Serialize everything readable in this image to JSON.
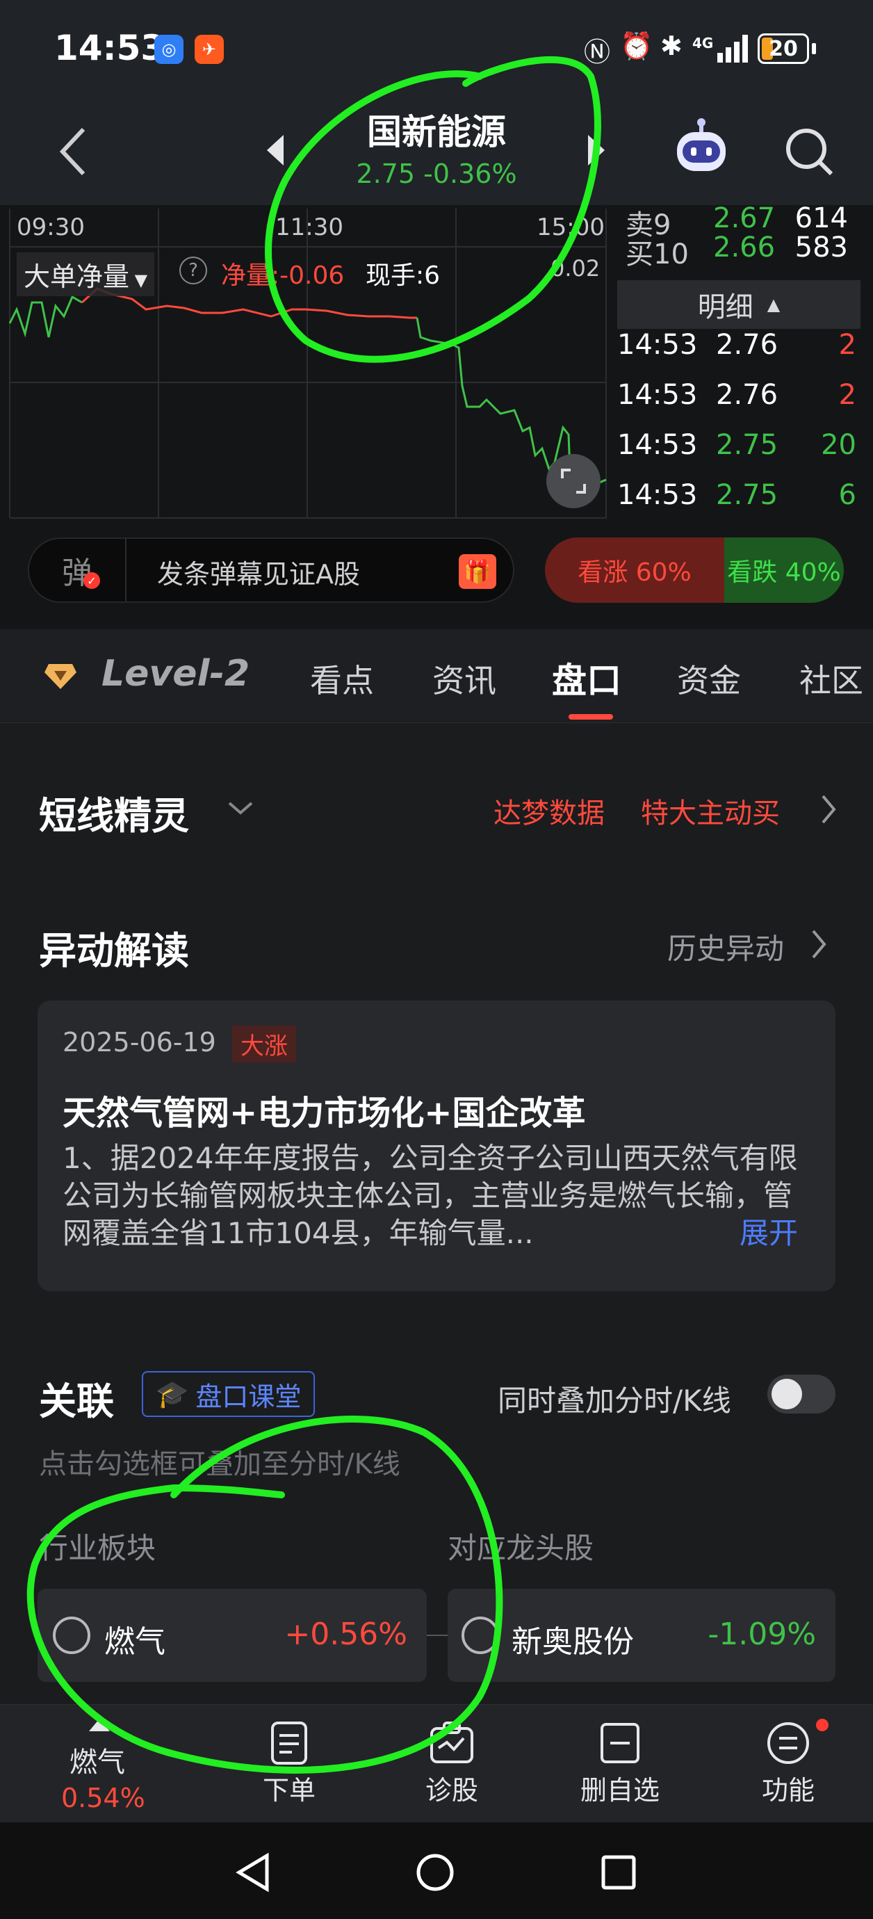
{
  "status": {
    "time": "14:53",
    "battery": "20",
    "network": "4G"
  },
  "header": {
    "title": "国新能源",
    "price": "2.75",
    "change": "-0.36%"
  },
  "chart": {
    "times": [
      "09:30",
      "11:30",
      "15:00"
    ],
    "indicator_label": "大单净量",
    "net_label": "净量:-0.06",
    "hand_label": "现手:6",
    "scale_value": "0.02"
  },
  "orderbook": {
    "rows": [
      {
        "label": "卖9",
        "price": "2.67",
        "vol": "614"
      },
      {
        "label": "买10",
        "price": "2.66",
        "vol": "583"
      }
    ]
  },
  "detail": {
    "title": "明细",
    "rows": [
      {
        "time": "14:53",
        "price": "2.76",
        "vol": "2"
      },
      {
        "time": "14:53",
        "price": "2.76",
        "vol": "2"
      },
      {
        "time": "14:53",
        "price": "2.75",
        "vol": "20"
      },
      {
        "time": "14:53",
        "price": "2.75",
        "vol": "6"
      }
    ]
  },
  "barrage": {
    "icon_char": "弹",
    "placeholder": "发条弹幕见证A股",
    "up_label": "看涨 60%",
    "down_label": "看跌 40%",
    "up_ratio": 0.6
  },
  "tabs": {
    "level2": "Level-2",
    "items": [
      "看点",
      "资讯",
      "盘口",
      "资金",
      "社区"
    ],
    "active": "盘口"
  },
  "shortline": {
    "title": "短线精灵",
    "link1": "达梦数据",
    "link2": "特大主动买"
  },
  "anomaly": {
    "title": "异动解读",
    "history_link": "历史异动",
    "date": "2025-06-19",
    "tag": "大涨",
    "headline": "天然气管网+电力市场化+国企改革",
    "body": "1、据2024年年度报告，公司全资子公司山西天然气有限公司为长输管网板块主体公司，主营业务是燃气长输，管网覆盖全省11市104县，年输气量...",
    "expand": "展开"
  },
  "related": {
    "title": "关联",
    "course_badge": "盘口课堂",
    "overlay_label": "同时叠加分时/K线",
    "hint": "点击勾选框可叠加至分时/K线",
    "col1": "行业板块",
    "col2": "对应龙头股",
    "sector": {
      "name": "燃气",
      "change": "+0.56%"
    },
    "leader": {
      "name": "新奥股份",
      "change": "-1.09%"
    }
  },
  "bottombar": {
    "sector_name": "燃气",
    "sector_change": "0.54%",
    "items": [
      "下单",
      "诊股",
      "删自选",
      "功能"
    ]
  },
  "colors": {
    "up": "#ff4a3d",
    "down": "#3fc24a",
    "link": "#4d7cff",
    "annotation": "#22ee22"
  }
}
